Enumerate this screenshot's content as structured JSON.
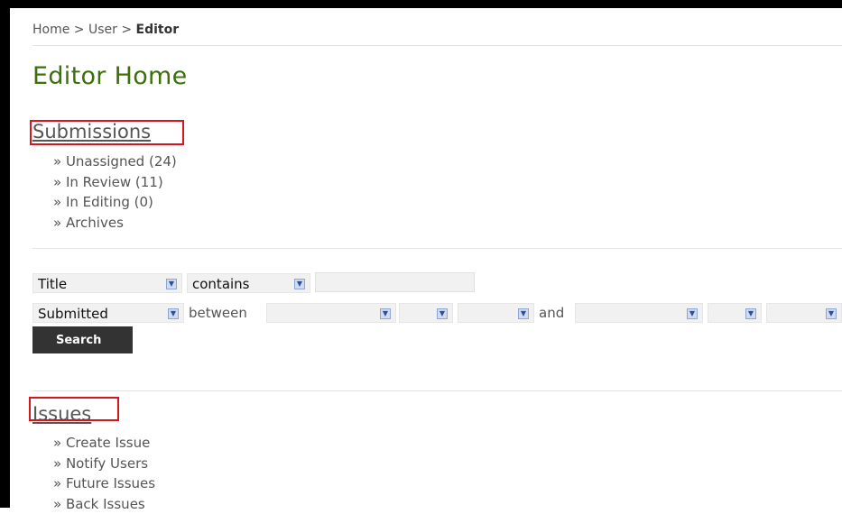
{
  "breadcrumb": {
    "home": "Home",
    "user": "User",
    "current": "Editor",
    "separator": ">"
  },
  "page_title": "Editor Home",
  "submissions": {
    "heading": "Submissions",
    "links": [
      "» Unassigned (24)",
      "» In Review (11)",
      "» In Editing (0)",
      "» Archives"
    ]
  },
  "search_form": {
    "field_select": "Title",
    "match_select": "contains",
    "search_text": "",
    "date_field_select": "Submitted",
    "between_label": "between",
    "and_label": "and",
    "from_month": "",
    "from_day": "",
    "from_year": "",
    "to_month": "",
    "to_day": "",
    "to_year": "",
    "search_button": "Search"
  },
  "issues": {
    "heading": "Issues",
    "links": [
      "» Create Issue",
      "» Notify Users",
      "» Future Issues",
      "» Back Issues"
    ]
  },
  "icons": {
    "dropdown_arrow": "chevron-down-icon"
  },
  "colors": {
    "title_green": "#3c7009",
    "annotation_red": "#d9141b",
    "button_dark": "#333333"
  }
}
